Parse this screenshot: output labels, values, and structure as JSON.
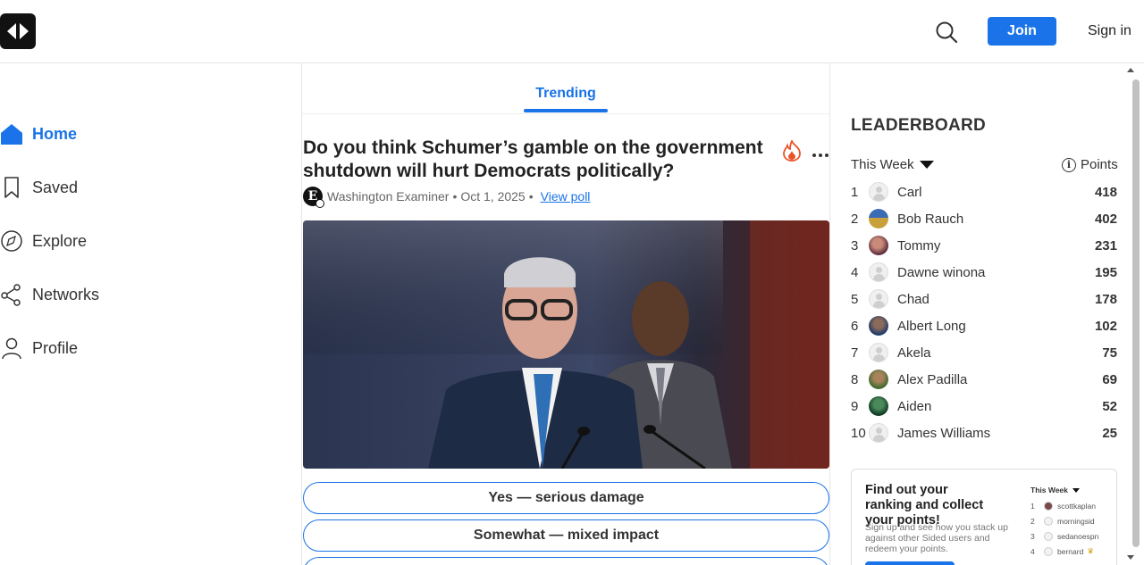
{
  "header": {
    "logo_icon": "sided-logo-icon",
    "search_icon": "search-icon",
    "join_label": "Join",
    "signin_label": "Sign in"
  },
  "nav": {
    "items": [
      {
        "label": "Home",
        "icon": "home-icon",
        "active": true
      },
      {
        "label": "Saved",
        "icon": "bookmark-icon",
        "active": false
      },
      {
        "label": "Explore",
        "icon": "compass-icon",
        "active": false
      },
      {
        "label": "Networks",
        "icon": "share-nodes-icon",
        "active": false
      },
      {
        "label": "Profile",
        "icon": "user-icon",
        "active": false
      }
    ]
  },
  "feed": {
    "active_tab": "Trending",
    "post": {
      "title": "Do you think Schumer’s gamble on the government shutdown will hurt Democrats politically?",
      "source_initial": "E",
      "source": "Washington Examiner",
      "separator": "•",
      "date": "Oct 1, 2025",
      "view_poll_label": "View poll",
      "options": [
        "Yes — serious damage",
        "Somewhat — mixed impact",
        ""
      ]
    }
  },
  "leaderboard": {
    "title": "LEADERBOARD",
    "period": "This Week",
    "points_label": "Points",
    "info_glyph": "i",
    "rows": [
      {
        "rank": "1",
        "name": "Carl",
        "points": "418",
        "avatar": "blank"
      },
      {
        "rank": "2",
        "name": "Bob Rauch",
        "points": "402",
        "avatar": "photo"
      },
      {
        "rank": "3",
        "name": "Tommy",
        "points": "231",
        "avatar": "photo"
      },
      {
        "rank": "4",
        "name": "Dawne winona",
        "points": "195",
        "avatar": "blank"
      },
      {
        "rank": "5",
        "name": "Chad",
        "points": "178",
        "avatar": "blank"
      },
      {
        "rank": "6",
        "name": "Albert Long",
        "points": "102",
        "avatar": "photo"
      },
      {
        "rank": "7",
        "name": "Akela",
        "points": "75",
        "avatar": "blank"
      },
      {
        "rank": "8",
        "name": "Alex Padilla",
        "points": "69",
        "avatar": "photo"
      },
      {
        "rank": "9",
        "name": "Aiden",
        "points": "52",
        "avatar": "photo"
      },
      {
        "rank": "10",
        "name": "James Williams",
        "points": "25",
        "avatar": "blank"
      }
    ],
    "promo": {
      "title": "Find out your ranking and collect your points!",
      "text": "Sign up and see how you stack up against other Sided users and redeem your points.",
      "mini_period": "This Week",
      "mini_rows": [
        {
          "rank": "1",
          "name": "scottkaplan"
        },
        {
          "rank": "2",
          "name": "morningsid"
        },
        {
          "rank": "3",
          "name": "sedanoespn"
        },
        {
          "rank": "4",
          "name": "bernard"
        }
      ]
    }
  },
  "colors": {
    "accent": "#1a73e8",
    "text": "#222222"
  }
}
